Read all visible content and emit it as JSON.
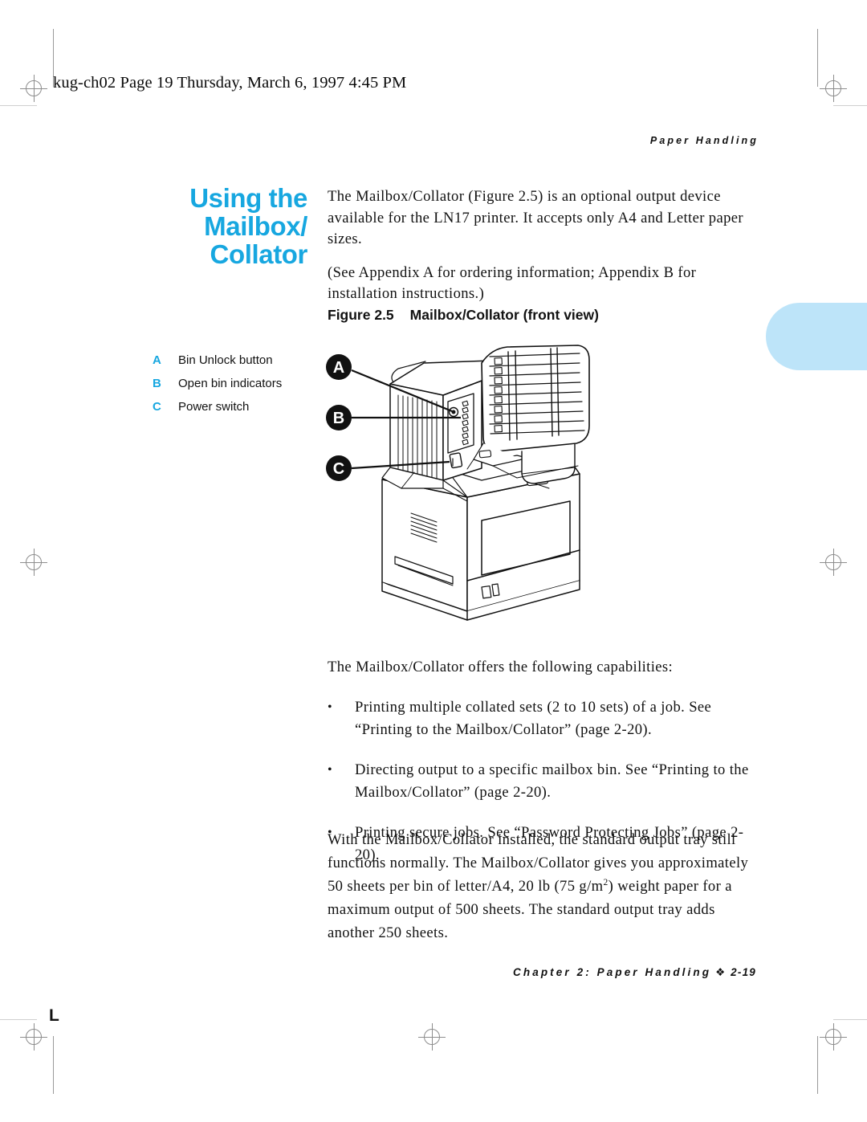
{
  "page": {
    "file_stamp": "kug-ch02  Page 19  Thursday, March 6, 1997  4:45 PM",
    "running_head": "Paper Handling",
    "corner_mark": "L"
  },
  "heading": {
    "line1": "Using the",
    "line2": "Mailbox/",
    "line3": "Collator",
    "color": "#17a7e0"
  },
  "intro": {
    "paragraph1": "The Mailbox/Collator (Figure 2.5) is an optional output device available for the LN17 printer. It accepts only A4 and Letter paper sizes.",
    "paragraph2": "(See Appendix A for ordering information; Appendix B for installation instructions.)"
  },
  "figure": {
    "caption_number": "Figure 2.5",
    "caption_title": "Mailbox/Collator (front view)",
    "legend": [
      {
        "key": "A",
        "label": "Bin Unlock button"
      },
      {
        "key": "B",
        "label": "Open bin indicators"
      },
      {
        "key": "C",
        "label": "Power switch"
      }
    ],
    "callouts": [
      {
        "key": "A"
      },
      {
        "key": "B"
      },
      {
        "key": "C"
      }
    ],
    "alt": "Line drawing of an LN17 laser printer with the Mailbox/Collator unit installed on top, showing the bin unlock button, open bin indicators and power switch."
  },
  "capabilities": {
    "intro": "The Mailbox/Collator offers the following capabilities:",
    "bullet_char": "•",
    "items": [
      "Printing multiple collated sets (2 to 10 sets) of a job. See “Printing to the Mailbox/Collator” (page 2-20).",
      "Directing output to a specific mailbox bin. See “Printing to the Mailbox/Collator” (page 2-20).",
      "Printing secure jobs. See “Password Protecting Jobs” (page 2-20)."
    ]
  },
  "closing": {
    "part1": "With the Mailbox/Collator installed, the standard output tray still functions normally. The Mailbox/Collator gives you approximately 50 sheets per bin of letter/A4, 20 lb (75 g/m",
    "superscript": "2",
    "part2": ") weight paper for a maximum output of 500 sheets. The standard output tray adds another 250 sheets."
  },
  "footer": {
    "chapter": "Chapter 2: Paper Handling",
    "diamond": "❖",
    "page_number": "2-19"
  },
  "colors": {
    "accent_blue": "#17a7e0",
    "tab_blue": "#bde4f9",
    "text": "#111111",
    "registration": "#8d8d8d"
  }
}
